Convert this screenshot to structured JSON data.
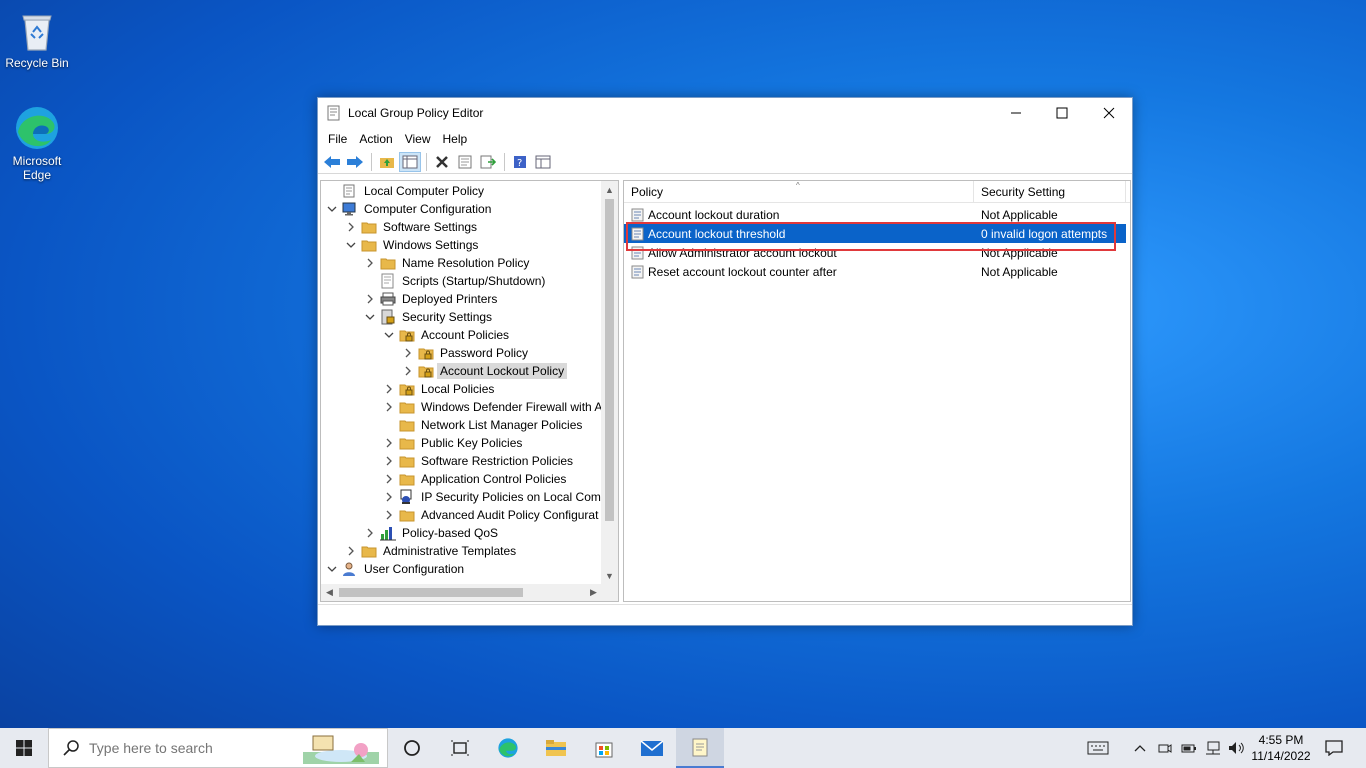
{
  "desktop": {
    "icons": [
      {
        "label": "Recycle Bin"
      },
      {
        "label": "Microsoft Edge"
      }
    ]
  },
  "window": {
    "title": "Local Group Policy Editor",
    "menu": [
      "File",
      "Action",
      "View",
      "Help"
    ],
    "tree": [
      {
        "label": "Local Computer Policy",
        "expander": "",
        "icon": "computer-policy-icon"
      },
      {
        "label": "Computer Configuration",
        "expander": "down",
        "icon": "computer-icon"
      },
      {
        "label": "Software Settings",
        "expander": "right",
        "icon": "folder-icon"
      },
      {
        "label": "Windows Settings",
        "expander": "down",
        "icon": "folder-icon"
      },
      {
        "label": "Name Resolution Policy",
        "expander": "right",
        "icon": "folder-icon"
      },
      {
        "label": "Scripts (Startup/Shutdown)",
        "expander": "",
        "icon": "script-icon"
      },
      {
        "label": "Deployed Printers",
        "expander": "right",
        "icon": "printer-icon"
      },
      {
        "label": "Security Settings",
        "expander": "down",
        "icon": "security-icon"
      },
      {
        "label": "Account Policies",
        "expander": "down",
        "icon": "lock-folder-icon"
      },
      {
        "label": "Password Policy",
        "expander": "right",
        "icon": "lock-folder-icon"
      },
      {
        "label": "Account Lockout Policy",
        "expander": "right",
        "icon": "lock-folder-icon",
        "selected": true
      },
      {
        "label": "Local Policies",
        "expander": "right",
        "icon": "lock-folder-icon"
      },
      {
        "label": "Windows Defender Firewall with A",
        "expander": "right",
        "icon": "folder-icon"
      },
      {
        "label": "Network List Manager Policies",
        "expander": "",
        "icon": "folder-icon"
      },
      {
        "label": "Public Key Policies",
        "expander": "right",
        "icon": "folder-icon"
      },
      {
        "label": "Software Restriction Policies",
        "expander": "right",
        "icon": "folder-icon"
      },
      {
        "label": "Application Control Policies",
        "expander": "right",
        "icon": "folder-icon"
      },
      {
        "label": "IP Security Policies on Local Comp",
        "expander": "right",
        "icon": "ipsec-icon"
      },
      {
        "label": "Advanced Audit Policy Configurat",
        "expander": "right",
        "icon": "folder-icon"
      },
      {
        "label": "Policy-based QoS",
        "expander": "right",
        "icon": "qos-chart-icon"
      },
      {
        "label": "Administrative Templates",
        "expander": "right",
        "icon": "folder-icon"
      },
      {
        "label": "User Configuration",
        "expander": "down",
        "icon": "user-icon"
      }
    ],
    "list": {
      "columns": [
        "Policy",
        "Security Setting"
      ],
      "rows": [
        {
          "policy": "Account lockout duration",
          "setting": "Not Applicable"
        },
        {
          "policy": "Account lockout threshold",
          "setting": "0 invalid logon attempts",
          "selected": true
        },
        {
          "policy": "Allow Administrator account lockout",
          "setting": "Not Applicable"
        },
        {
          "policy": "Reset account lockout counter after",
          "setting": "Not Applicable"
        }
      ]
    }
  },
  "taskbar": {
    "search_placeholder": "Type here to search",
    "time": "4:55 PM",
    "date": "11/14/2022"
  },
  "colors": {
    "selection": "#0a63c9",
    "highlight_box": "#e0393b",
    "folder": "#e8b84a"
  }
}
